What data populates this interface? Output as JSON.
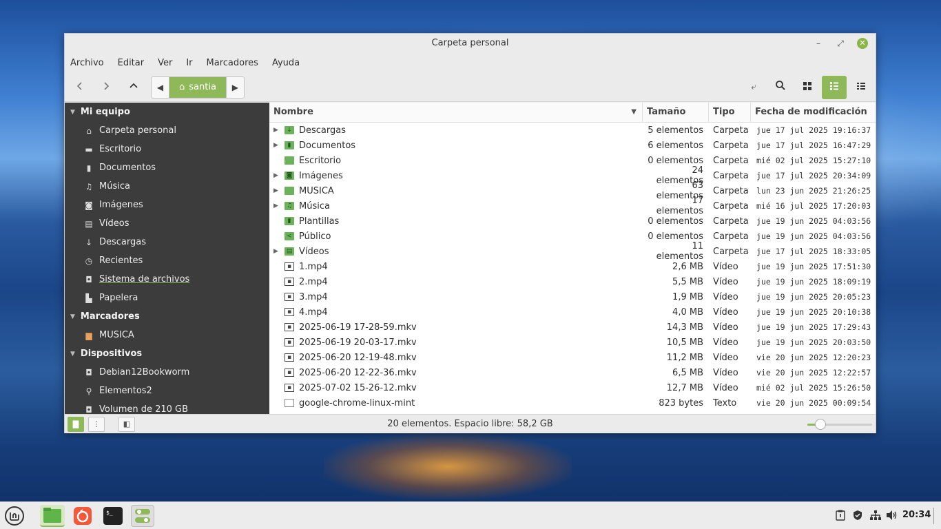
{
  "window": {
    "title": "Carpeta personal"
  },
  "menu": [
    "Archivo",
    "Editar",
    "Ver",
    "Ir",
    "Marcadores",
    "Ayuda"
  ],
  "path": {
    "current": "santia"
  },
  "sidebar": {
    "sections": [
      {
        "title": "Mi equipo",
        "items": [
          {
            "label": "Carpeta personal",
            "icon": "home-icon"
          },
          {
            "label": "Escritorio",
            "icon": "desktop-icon"
          },
          {
            "label": "Documentos",
            "icon": "document-icon"
          },
          {
            "label": "Música",
            "icon": "music-icon"
          },
          {
            "label": "Imágenes",
            "icon": "camera-icon"
          },
          {
            "label": "Vídeos",
            "icon": "film-icon"
          },
          {
            "label": "Descargas",
            "icon": "download-icon"
          },
          {
            "label": "Recientes",
            "icon": "clock-icon"
          },
          {
            "label": "Sistema de archivos",
            "icon": "drive-icon"
          },
          {
            "label": "Papelera",
            "icon": "trash-icon"
          }
        ]
      },
      {
        "title": "Marcadores",
        "items": [
          {
            "label": "MUSICA",
            "icon": "folder-warning-icon"
          }
        ]
      },
      {
        "title": "Dispositivos",
        "items": [
          {
            "label": "Debian12Bookworm",
            "icon": "drive-icon"
          },
          {
            "label": "Elementos2",
            "icon": "usb-icon"
          },
          {
            "label": "Volumen de 210 GB",
            "icon": "drive-icon"
          }
        ]
      }
    ]
  },
  "columns": {
    "name": "Nombre",
    "size": "Tamaño",
    "type": "Tipo",
    "date": "Fecha de modificación"
  },
  "files": [
    {
      "name": "Descargas",
      "size": "5 elementos",
      "type": "Carpeta",
      "date": "jue 17 jul 2025 19:16:37",
      "kind": "folder",
      "expandable": true,
      "icon": "folder-download-icon"
    },
    {
      "name": "Documentos",
      "size": "6 elementos",
      "type": "Carpeta",
      "date": "jue 17 jul 2025 16:47:29",
      "kind": "folder",
      "expandable": true,
      "icon": "folder-documents-icon"
    },
    {
      "name": "Escritorio",
      "size": "0 elementos",
      "type": "Carpeta",
      "date": "mié 02 jul 2025 15:27:10",
      "kind": "folder",
      "expandable": false,
      "icon": "folder-desktop-icon"
    },
    {
      "name": "Imágenes",
      "size": "24 elementos",
      "type": "Carpeta",
      "date": "jue 17 jul 2025 20:34:09",
      "kind": "folder",
      "expandable": true,
      "icon": "folder-pictures-icon"
    },
    {
      "name": "MUSICA",
      "size": "63 elementos",
      "type": "Carpeta",
      "date": "lun 23 jun 2025 21:26:25",
      "kind": "folder",
      "expandable": true,
      "icon": "folder-icon"
    },
    {
      "name": "Música",
      "size": "17 elementos",
      "type": "Carpeta",
      "date": "mié 16 jul 2025 17:20:03",
      "kind": "folder",
      "expandable": true,
      "icon": "folder-music-icon"
    },
    {
      "name": "Plantillas",
      "size": "0 elementos",
      "type": "Carpeta",
      "date": "jue 19 jun 2025 04:03:56",
      "kind": "folder",
      "expandable": false,
      "icon": "folder-templates-icon"
    },
    {
      "name": "Público",
      "size": "0 elementos",
      "type": "Carpeta",
      "date": "jue 19 jun 2025 04:03:56",
      "kind": "folder",
      "expandable": false,
      "icon": "folder-public-icon"
    },
    {
      "name": "Vídeos",
      "size": "11 elementos",
      "type": "Carpeta",
      "date": "jue 17 jul 2025 18:33:05",
      "kind": "folder",
      "expandable": true,
      "icon": "folder-videos-icon"
    },
    {
      "name": "1.mp4",
      "size": "2,6 MB",
      "type": "Vídeo",
      "date": "jue 19 jun 2025 17:51:30",
      "kind": "video",
      "expandable": false,
      "icon": "video-file-icon"
    },
    {
      "name": "2.mp4",
      "size": "5,5 MB",
      "type": "Vídeo",
      "date": "jue 19 jun 2025 18:09:19",
      "kind": "video",
      "expandable": false,
      "icon": "video-file-icon"
    },
    {
      "name": "3.mp4",
      "size": "1,9 MB",
      "type": "Vídeo",
      "date": "jue 19 jun 2025 20:05:23",
      "kind": "video",
      "expandable": false,
      "icon": "video-file-icon"
    },
    {
      "name": "4.mp4",
      "size": "4,0 MB",
      "type": "Vídeo",
      "date": "jue 19 jun 2025 20:10:38",
      "kind": "video",
      "expandable": false,
      "icon": "video-file-icon"
    },
    {
      "name": "2025-06-19 17-28-59.mkv",
      "size": "14,3 MB",
      "type": "Vídeo",
      "date": "jue 19 jun 2025 17:29:43",
      "kind": "video",
      "expandable": false,
      "icon": "video-file-icon"
    },
    {
      "name": "2025-06-19 20-03-17.mkv",
      "size": "10,5 MB",
      "type": "Vídeo",
      "date": "jue 19 jun 2025 20:03:50",
      "kind": "video",
      "expandable": false,
      "icon": "video-file-icon"
    },
    {
      "name": "2025-06-20 12-19-48.mkv",
      "size": "11,2 MB",
      "type": "Vídeo",
      "date": "vie 20 jun 2025 12:20:23",
      "kind": "video",
      "expandable": false,
      "icon": "video-file-icon"
    },
    {
      "name": "2025-06-20 12-22-36.mkv",
      "size": "6,5 MB",
      "type": "Vídeo",
      "date": "vie 20 jun 2025 12:22:57",
      "kind": "video",
      "expandable": false,
      "icon": "video-file-icon"
    },
    {
      "name": "2025-07-02 15-26-12.mkv",
      "size": "12,7 MB",
      "type": "Vídeo",
      "date": "mié 02 jul 2025 15:26:50",
      "kind": "video",
      "expandable": false,
      "icon": "video-file-icon"
    },
    {
      "name": "google-chrome-linux-mint",
      "size": "823 bytes",
      "type": "Texto",
      "date": "vie 20 jun 2025 00:09:54",
      "kind": "text",
      "expandable": false,
      "icon": "text-file-icon"
    }
  ],
  "status": {
    "text": "20 elementos. Espacio libre: 58,2 GB",
    "zoom_level": 0.2
  },
  "taskbar": {
    "clock": "20:34"
  },
  "colors": {
    "accent": "#8fb858",
    "sidebar_bg": "#3c3c3c",
    "folder": "#6cb25c"
  }
}
